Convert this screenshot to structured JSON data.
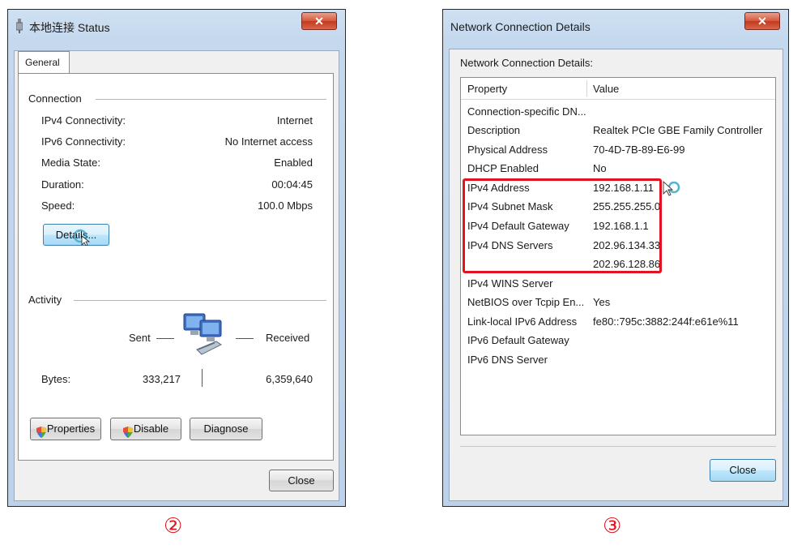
{
  "status_window": {
    "title": "本地连接 Status",
    "tab": "General",
    "connection_heading": "Connection",
    "rows": [
      {
        "label": "IPv4 Connectivity:",
        "value": "Internet"
      },
      {
        "label": "IPv6 Connectivity:",
        "value": "No Internet access"
      },
      {
        "label": "Media State:",
        "value": "Enabled"
      },
      {
        "label": "Duration:",
        "value": "00:04:45"
      },
      {
        "label": "Speed:",
        "value": "100.0 Mbps"
      }
    ],
    "details_button": "Details...",
    "activity_heading": "Activity",
    "sent_label": "Sent",
    "received_label": "Received",
    "bytes_label": "Bytes:",
    "bytes_sent": "333,217",
    "bytes_received": "6,359,640",
    "properties_button": "Properties",
    "disable_button": "Disable",
    "diagnose_button": "Diagnose",
    "close_button": "Close",
    "step_label": "②"
  },
  "details_window": {
    "title": "Network Connection Details",
    "heading": "Network Connection Details:",
    "columns": [
      "Property",
      "Value"
    ],
    "rows": [
      {
        "property": "Connection-specific DN...",
        "value": ""
      },
      {
        "property": "Description",
        "value": "Realtek PCIe GBE Family Controller"
      },
      {
        "property": "Physical Address",
        "value": "70-4D-7B-89-E6-99"
      },
      {
        "property": "DHCP Enabled",
        "value": "No"
      },
      {
        "property": "IPv4 Address",
        "value": "192.168.1.11"
      },
      {
        "property": "IPv4 Subnet Mask",
        "value": "255.255.255.0"
      },
      {
        "property": "IPv4 Default Gateway",
        "value": "192.168.1.1"
      },
      {
        "property": "IPv4 DNS Servers",
        "value": "202.96.134.33"
      },
      {
        "property": "",
        "value": "202.96.128.86"
      },
      {
        "property": "IPv4 WINS Server",
        "value": ""
      },
      {
        "property": "NetBIOS over Tcpip En...",
        "value": "Yes"
      },
      {
        "property": "Link-local IPv6 Address",
        "value": "fe80::795c:3882:244f:e61e%11"
      },
      {
        "property": "IPv6 Default Gateway",
        "value": ""
      },
      {
        "property": "IPv6 DNS Server",
        "value": ""
      }
    ],
    "close_button": "Close",
    "step_label": "③"
  },
  "colors": {
    "highlight_box": "#e0141e",
    "step_label": "#e0141e",
    "title_bar": "#c4d8ee"
  }
}
